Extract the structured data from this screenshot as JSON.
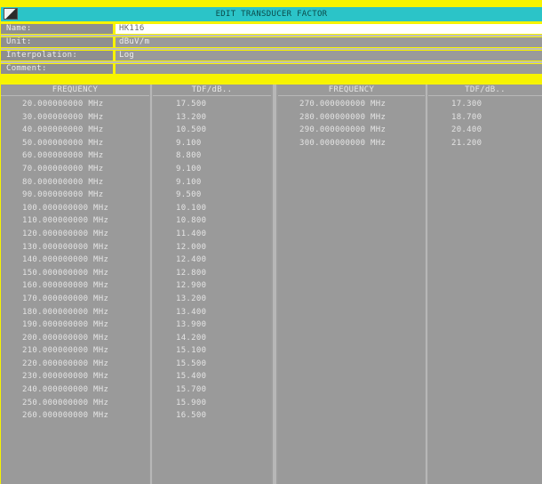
{
  "title": "EDIT TRANSDUCER FACTOR",
  "header": {
    "name_label": "Name:",
    "name_value": "HK116",
    "unit_label": "Unit:",
    "unit_value": "dBuV/m",
    "interp_label": "Interpolation:",
    "interp_value": "Log",
    "comment_label": "Comment:",
    "comment_value": ""
  },
  "table": {
    "left_freq_header": "FREQUENCY",
    "left_tdf_header": "TDF/dB..",
    "right_freq_header": "FREQUENCY",
    "right_tdf_header": "TDF/dB..",
    "left_rows": [
      {
        "freq": "20.000000000 MHz",
        "tdf": "17.500"
      },
      {
        "freq": "30.000000000 MHz",
        "tdf": "13.200"
      },
      {
        "freq": "40.000000000 MHz",
        "tdf": "10.500"
      },
      {
        "freq": "50.000000000 MHz",
        "tdf": "9.100"
      },
      {
        "freq": "60.000000000 MHz",
        "tdf": "8.800"
      },
      {
        "freq": "70.000000000 MHz",
        "tdf": "9.100"
      },
      {
        "freq": "80.000000000 MHz",
        "tdf": "9.100"
      },
      {
        "freq": "90.000000000 MHz",
        "tdf": "9.500"
      },
      {
        "freq": "100.000000000 MHz",
        "tdf": "10.100"
      },
      {
        "freq": "110.000000000 MHz",
        "tdf": "10.800"
      },
      {
        "freq": "120.000000000 MHz",
        "tdf": "11.400"
      },
      {
        "freq": "130.000000000 MHz",
        "tdf": "12.000"
      },
      {
        "freq": "140.000000000 MHz",
        "tdf": "12.400"
      },
      {
        "freq": "150.000000000 MHz",
        "tdf": "12.800"
      },
      {
        "freq": "160.000000000 MHz",
        "tdf": "12.900"
      },
      {
        "freq": "170.000000000 MHz",
        "tdf": "13.200"
      },
      {
        "freq": "180.000000000 MHz",
        "tdf": "13.400"
      },
      {
        "freq": "190.000000000 MHz",
        "tdf": "13.900"
      },
      {
        "freq": "200.000000000 MHz",
        "tdf": "14.200"
      },
      {
        "freq": "210.000000000 MHz",
        "tdf": "15.100"
      },
      {
        "freq": "220.000000000 MHz",
        "tdf": "15.500"
      },
      {
        "freq": "230.000000000 MHz",
        "tdf": "15.400"
      },
      {
        "freq": "240.000000000 MHz",
        "tdf": "15.700"
      },
      {
        "freq": "250.000000000 MHz",
        "tdf": "15.900"
      },
      {
        "freq": "260.000000000 MHz",
        "tdf": "16.500"
      }
    ],
    "right_rows": [
      {
        "freq": "270.000000000 MHz",
        "tdf": "17.300"
      },
      {
        "freq": "280.000000000 MHz",
        "tdf": "18.700"
      },
      {
        "freq": "290.000000000 MHz",
        "tdf": "20.400"
      },
      {
        "freq": "300.000000000 MHz",
        "tdf": "21.200"
      }
    ]
  }
}
